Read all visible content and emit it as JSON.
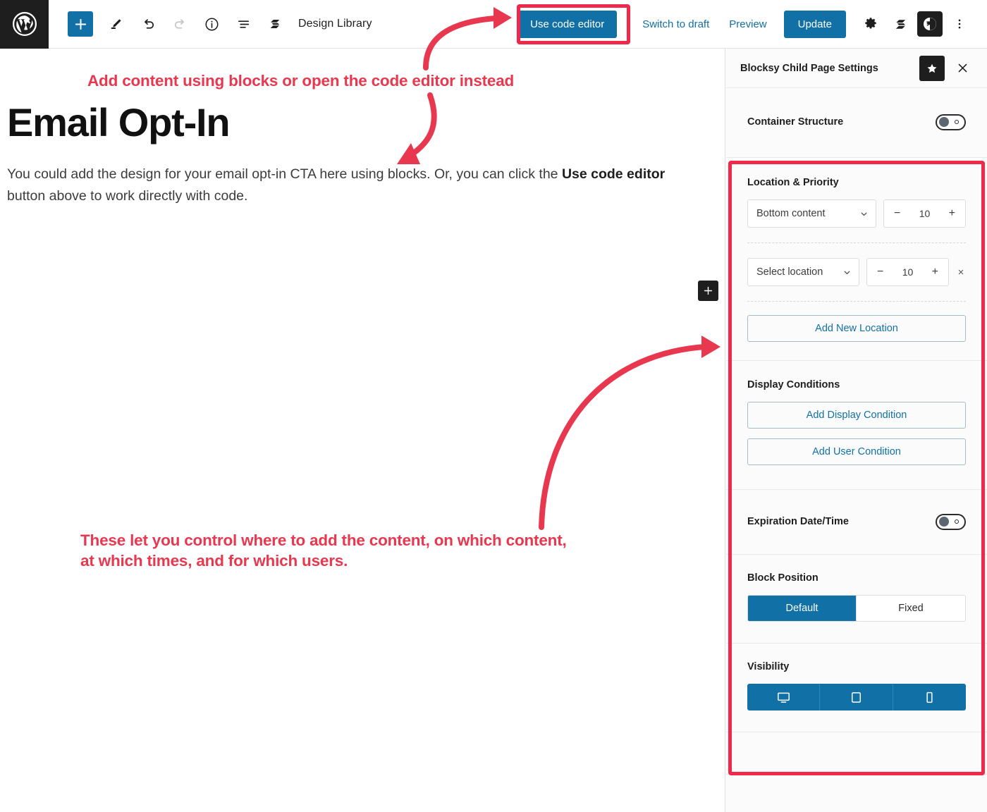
{
  "toolbar": {
    "wp_logo_title": "WordPress",
    "left_icons": [
      {
        "name": "add-block-icon",
        "label": "Add block"
      },
      {
        "name": "edit-pencil-icon",
        "label": "Tools"
      },
      {
        "name": "undo-icon",
        "label": "Undo"
      },
      {
        "name": "redo-icon",
        "label": "Redo"
      },
      {
        "name": "info-icon",
        "label": "Details"
      },
      {
        "name": "list-view-icon",
        "label": "List view"
      },
      {
        "name": "stackable-logo-icon",
        "label": "Stackable"
      }
    ],
    "design_library_label": "Design Library",
    "use_code_editor_label": "Use code editor",
    "switch_to_draft_label": "Switch to draft",
    "preview_label": "Preview",
    "update_label": "Update",
    "right_icons": [
      {
        "name": "settings-gear-icon",
        "label": "Settings"
      },
      {
        "name": "stackable-logo-icon",
        "label": "Stackable"
      },
      {
        "name": "blocksy-logo-icon",
        "label": "Blocksy"
      },
      {
        "name": "more-options-icon",
        "label": "Options"
      }
    ]
  },
  "content": {
    "title": "Email Opt-In",
    "paragraph_part1": "You could add the design for your email opt-in CTA here using blocks. Or, you can click the ",
    "paragraph_bold": "Use code editor",
    "paragraph_part2": " button above to work directly with code.",
    "inserter_label": "+"
  },
  "sidebar": {
    "title": "Blocksy Child Page Settings",
    "pin_icon": "star-icon",
    "close_icon": "close-icon",
    "container_structure": {
      "label": "Container Structure",
      "enabled": false
    },
    "location_priority": {
      "title": "Location & Priority",
      "rows": [
        {
          "location": "Bottom content",
          "priority": "10",
          "removable": false
        },
        {
          "location": "Select location",
          "priority": "10",
          "removable": true
        }
      ],
      "minus_label": "−",
      "plus_label": "+",
      "remove_label": "×",
      "add_new_location_label": "Add New Location"
    },
    "display_conditions": {
      "title": "Display Conditions",
      "add_display_condition_label": "Add Display Condition",
      "add_user_condition_label": "Add User Condition"
    },
    "expiration": {
      "label": "Expiration Date/Time",
      "enabled": false
    },
    "block_position": {
      "title": "Block Position",
      "options": [
        "Default",
        "Fixed"
      ],
      "selected": "Default"
    },
    "visibility": {
      "title": "Visibility",
      "devices": [
        {
          "name": "desktop-icon",
          "active": true
        },
        {
          "name": "tablet-icon",
          "active": true
        },
        {
          "name": "mobile-icon",
          "active": true
        }
      ]
    }
  },
  "annotations": {
    "top_text": "Add content using blocks or open the code editor instead",
    "bottom_line1": "These let you control where to add the content, on which content,",
    "bottom_line2": "at which times, and for which users.",
    "accent_color": "#e8384f",
    "highlight_color": "#f0294a"
  }
}
